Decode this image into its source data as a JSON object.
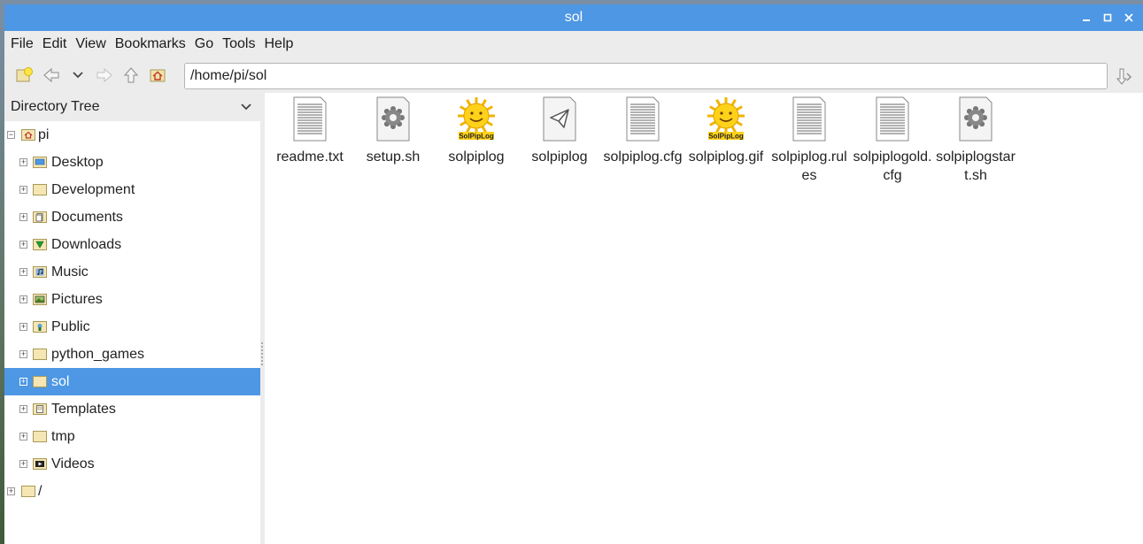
{
  "window": {
    "title": "sol"
  },
  "menu": [
    "File",
    "Edit",
    "View",
    "Bookmarks",
    "Go",
    "Tools",
    "Help"
  ],
  "path": "/home/pi/sol",
  "sidebar": {
    "header": "Directory Tree",
    "root": "pi",
    "items": [
      {
        "label": "Desktop",
        "icon": "desktop-folder-icon"
      },
      {
        "label": "Development",
        "icon": "folder-icon"
      },
      {
        "label": "Documents",
        "icon": "documents-folder-icon"
      },
      {
        "label": "Downloads",
        "icon": "downloads-folder-icon"
      },
      {
        "label": "Music",
        "icon": "music-folder-icon"
      },
      {
        "label": "Pictures",
        "icon": "pictures-folder-icon"
      },
      {
        "label": "Public",
        "icon": "public-folder-icon"
      },
      {
        "label": "python_games",
        "icon": "folder-icon"
      },
      {
        "label": "sol",
        "icon": "folder-icon",
        "selected": true
      },
      {
        "label": "Templates",
        "icon": "templates-folder-icon"
      },
      {
        "label": "tmp",
        "icon": "folder-icon"
      },
      {
        "label": "Videos",
        "icon": "videos-folder-icon"
      }
    ],
    "filesystem_root": "/"
  },
  "files": [
    {
      "name": "readme.txt",
      "icon": "text-file-icon"
    },
    {
      "name": "setup.sh",
      "icon": "script-gear-icon"
    },
    {
      "name": "solpiplog",
      "icon": "solpiplog-sun-icon"
    },
    {
      "name": "solpiplog",
      "icon": "paper-plane-file-icon"
    },
    {
      "name": "solpiplog.cfg",
      "icon": "text-file-icon"
    },
    {
      "name": "solpiplog.gif",
      "icon": "solpiplog-sun-icon"
    },
    {
      "name": "solpiplog.rules",
      "icon": "text-file-icon"
    },
    {
      "name": "solpiplogold.cfg",
      "icon": "text-file-icon"
    },
    {
      "name": "solpiplogstart.sh",
      "icon": "script-gear-icon"
    }
  ],
  "logo_text": "SolPipLog",
  "colors": {
    "accent": "#4d97e4",
    "folder": "#f5e6b3"
  }
}
